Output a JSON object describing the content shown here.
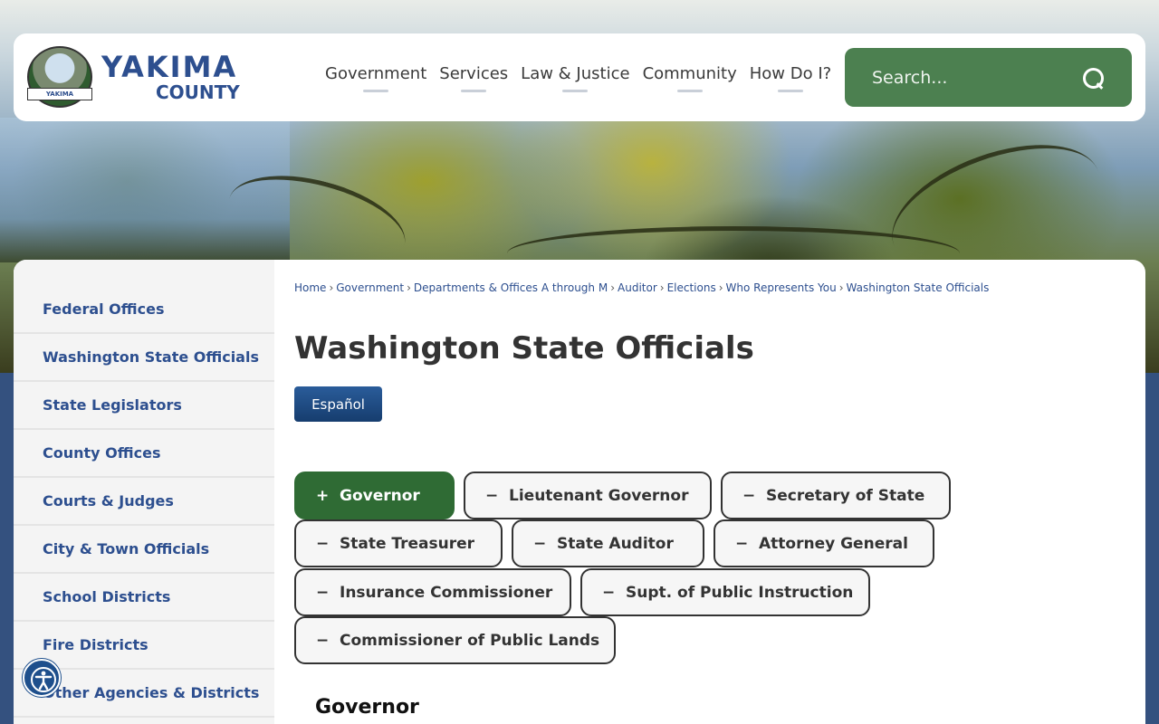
{
  "logo": {
    "line1": "YAKIMA",
    "line2": "COUNTY",
    "seal_text": "YAKIMA"
  },
  "nav": [
    "Government",
    "Services",
    "Law & Justice",
    "Community",
    "How Do I?"
  ],
  "search": {
    "placeholder": "Search..."
  },
  "sidebar": [
    "Federal Offices",
    "Washington State Officials",
    "State Legislators",
    "County Offices",
    "Courts & Judges",
    "City & Town Officials",
    "School Districts",
    "Fire Districts",
    "Other Agencies & Districts"
  ],
  "breadcrumb": [
    "Home",
    "Government",
    "Departments & Offices A through M",
    "Auditor",
    "Elections",
    "Who Represents You",
    "Washington State Officials"
  ],
  "page_title": "Washington State Officials",
  "espanol_label": "Español",
  "tabs": [
    {
      "label": "Governor",
      "sign": "+",
      "active": true
    },
    {
      "label": "Lieutenant Governor",
      "sign": "−",
      "active": false
    },
    {
      "label": "Secretary of State",
      "sign": "−",
      "active": false
    },
    {
      "label": "State Treasurer",
      "sign": "−",
      "active": false
    },
    {
      "label": "State Auditor",
      "sign": "−",
      "active": false
    },
    {
      "label": "Attorney General",
      "sign": "−",
      "active": false
    },
    {
      "label": "Insurance Commissioner",
      "sign": "−",
      "active": false
    },
    {
      "label": "Supt. of Public Instruction",
      "sign": "−",
      "active": false
    },
    {
      "label": "Commissioner of Public Lands",
      "sign": "−",
      "active": false
    }
  ],
  "section_heading": "Governor",
  "colors": {
    "brand_blue": "#2d4f8f",
    "search_green": "#4c8050",
    "active_tab": "#2f6b34"
  }
}
